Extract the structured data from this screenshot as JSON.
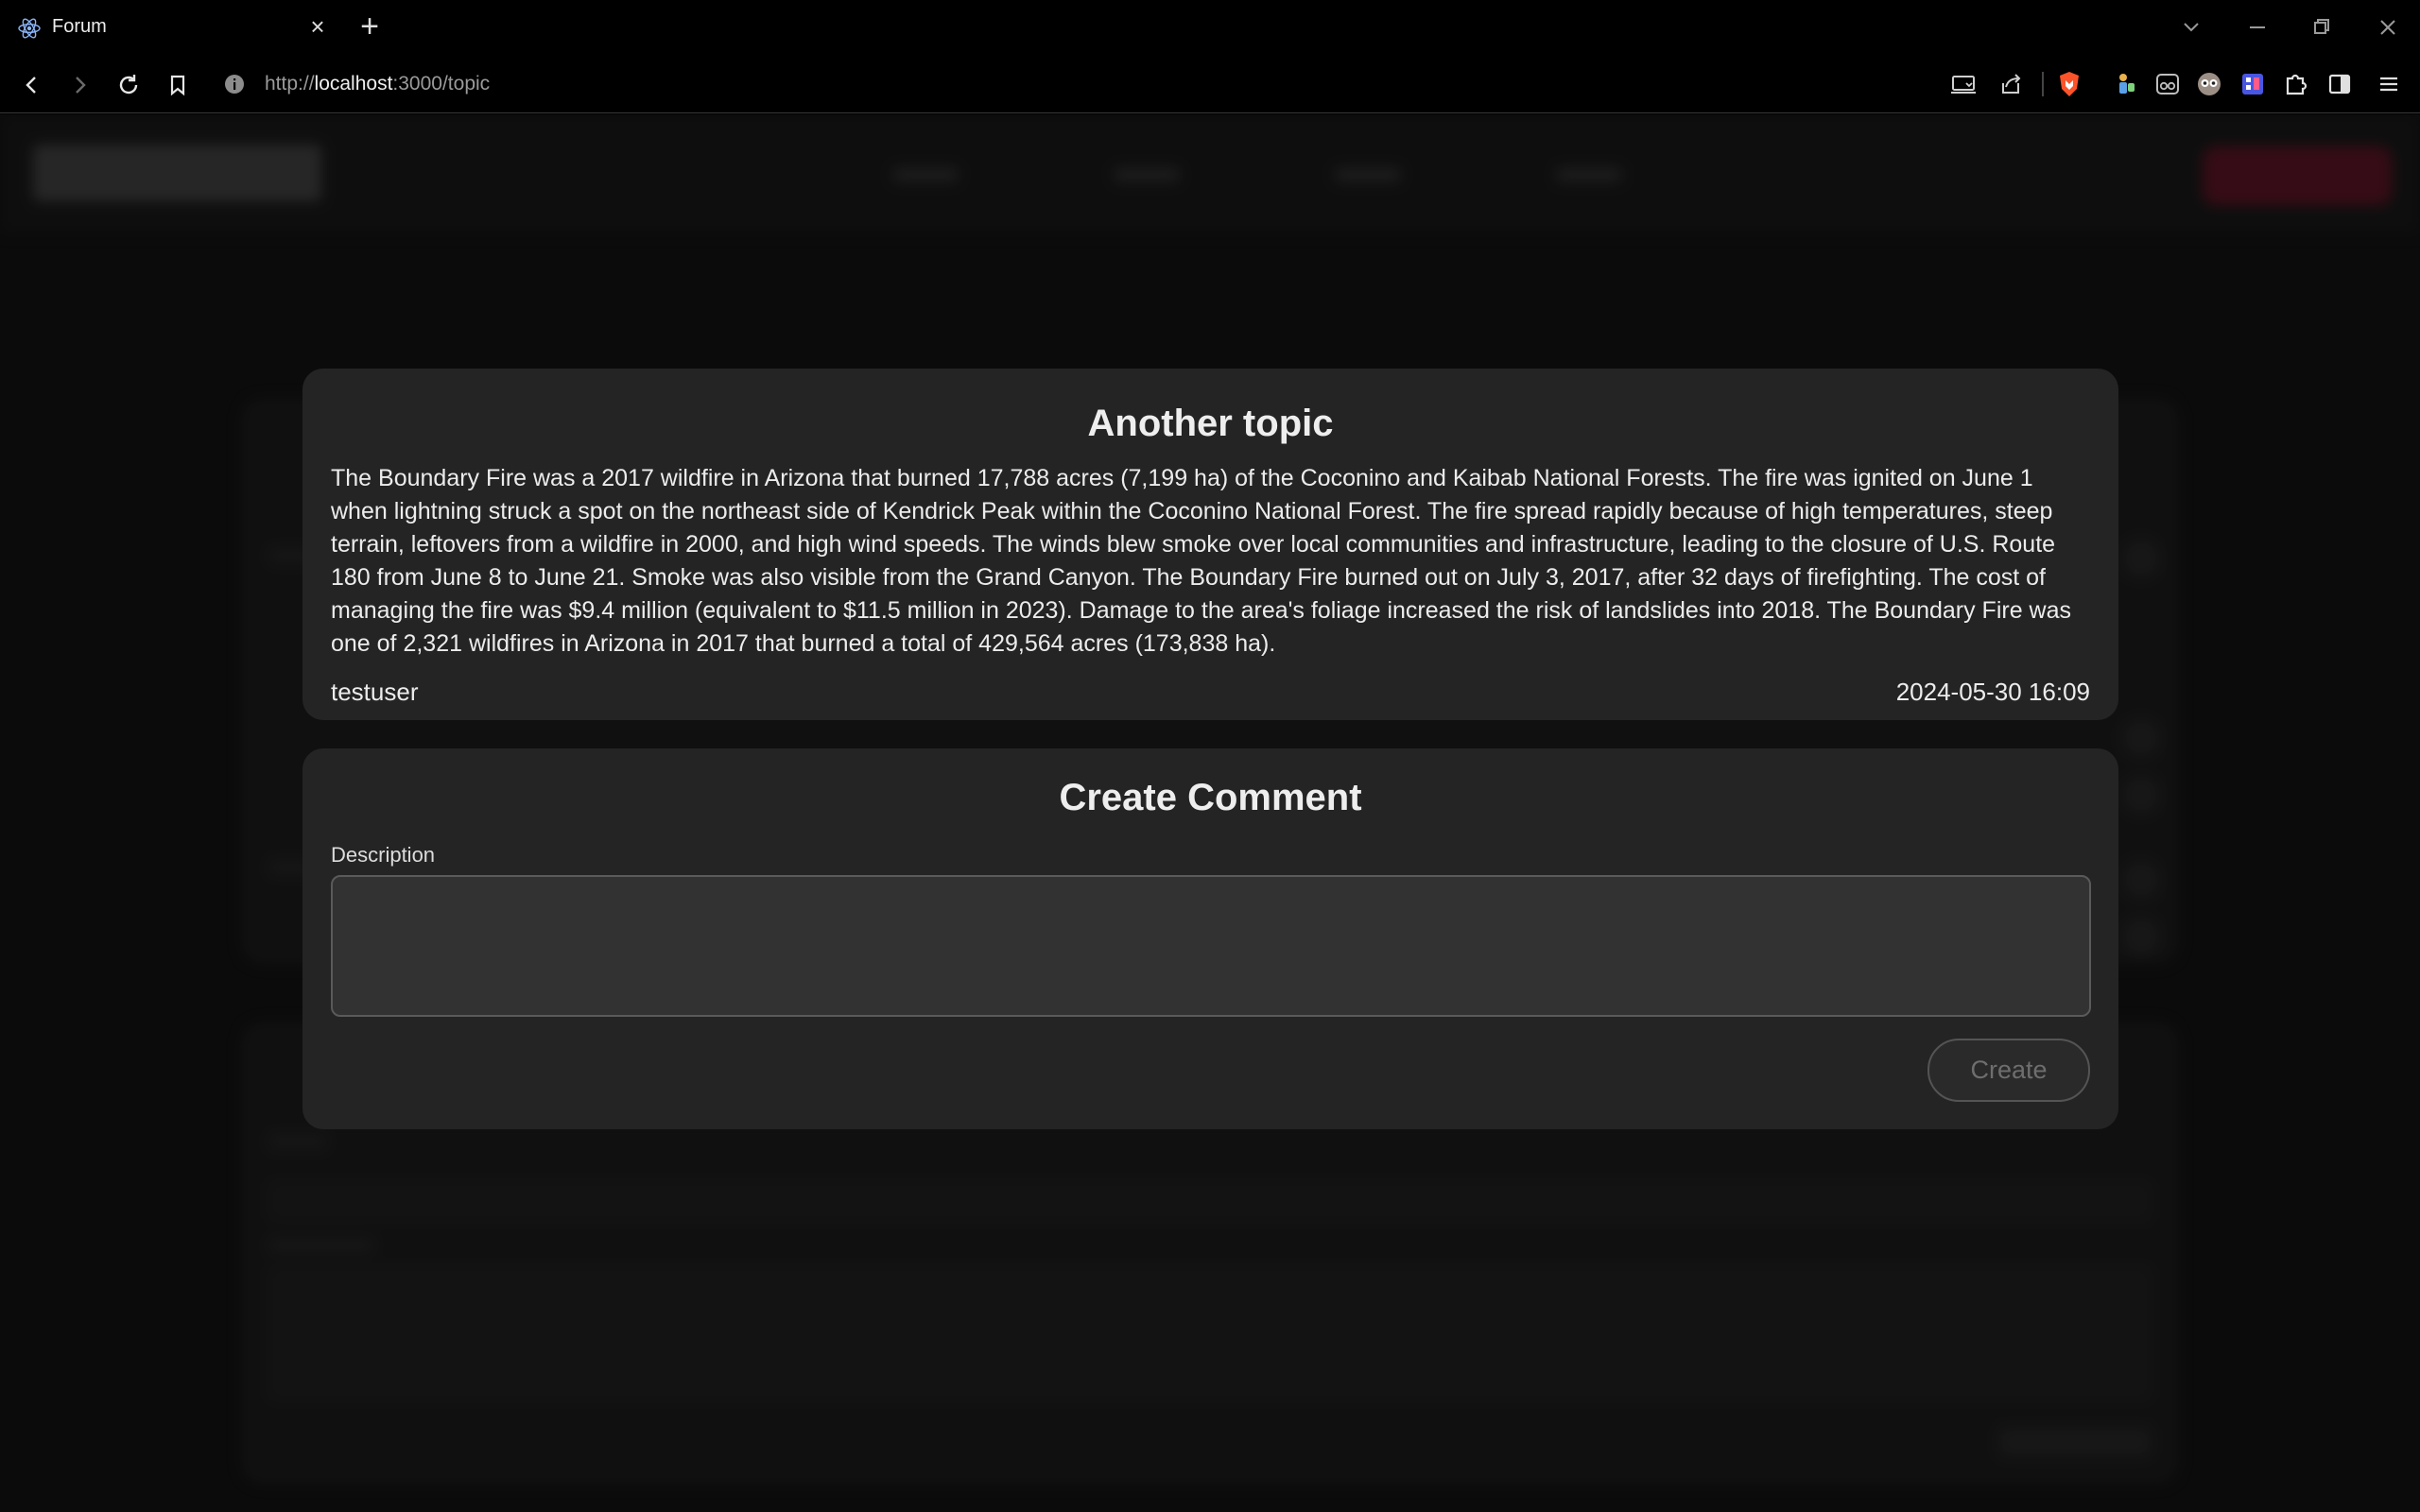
{
  "browser": {
    "tab_title": "Forum",
    "new_tab": "+",
    "url_host": "localhost",
    "url_prefix": "http://",
    "url_suffix": ":3000/topic"
  },
  "topic": {
    "title": "Another topic",
    "body": "The Boundary Fire was a 2017 wildfire in Arizona that burned 17,788 acres (7,199 ha) of the Coconino and Kaibab National Forests. The fire was ignited on June 1 when lightning struck a spot on the northeast side of Kendrick Peak within the Coconino National Forest. The fire spread rapidly because of high temperatures, steep terrain, leftovers from a wildfire in 2000, and high wind speeds. The winds blew smoke over local communities and infrastructure, leading to the closure of U.S. Route 180 from June 8 to June 21. Smoke was also visible from the Grand Canyon. The Boundary Fire burned out on July 3, 2017, after 32 days of firefighting. The cost of managing the fire was $9.4 million (equivalent to $11.5 million in 2023). Damage to the area's foliage increased the risk of landslides into 2018. The Boundary Fire was one of 2,321 wildfires in Arizona in 2017 that burned a total of 429,564 acres (173,838 ha).",
    "author": "testuser",
    "date": "2024-05-30 16:09"
  },
  "comment_form": {
    "title": "Create Comment",
    "description_label": "Description",
    "description_value": "",
    "submit_label": "Create"
  },
  "colors": {
    "accent": "#9c1a36",
    "card": "#242424",
    "page": "#131313"
  }
}
